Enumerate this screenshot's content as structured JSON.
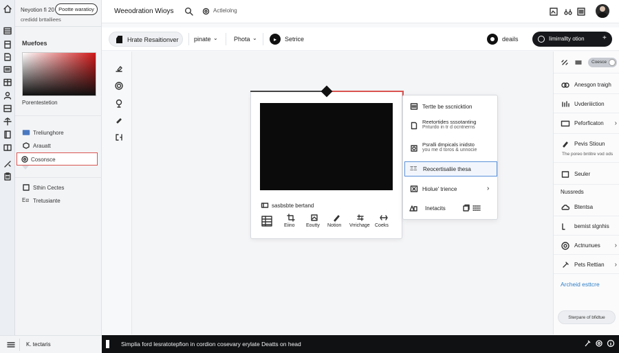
{
  "sidebar": {
    "header_line1": "Neyotion fi 20",
    "header_line2": "credidd brttalliees",
    "header_button": "Pootte waratioy",
    "section_title": "Muefoes",
    "color_label": "Porentestetion",
    "items": [
      {
        "label": "Treliunghore",
        "icon": "layers-icon"
      },
      {
        "label": "Arauatt",
        "icon": "cube-icon"
      },
      {
        "label": "Cosonsce",
        "icon": "circle-icon"
      }
    ],
    "items2": [
      {
        "label": "Sthin Cectes",
        "icon": "square-icon"
      },
      {
        "label": "Tretusiante",
        "icon": "text-icon"
      }
    ],
    "footer_label": "K. tectaris"
  },
  "topbar": {
    "title": "Weeodration Wioys",
    "search_label": "Actlelolng"
  },
  "toolbar": {
    "primary_chip": "Hrate Resaitionver",
    "dropdown1": "pinate",
    "dropdown2": "Phota",
    "service_label": "Setrice",
    "details_label": "deails",
    "action_button": "Iimirrallty otion"
  },
  "frame": {
    "caption": "sasbsbte bertand",
    "actions": [
      "Eiino",
      "Eoutty",
      "Notion",
      "Vrrichage",
      "Coeks"
    ]
  },
  "context_menu": {
    "items": [
      {
        "label": "Tertte be sscnicktion"
      },
      {
        "label": "Reetortides sssotanting",
        "sub": "Pnturdo in tr d ocntnerns"
      },
      {
        "label": "Psralli dmpicals inidsto",
        "sub": "you me d toros & unnocie"
      },
      {
        "label": "Reocertisaliie thesa"
      },
      {
        "label": "Hiolue' trience"
      },
      {
        "label": "Inetacits"
      }
    ]
  },
  "rightpanel": {
    "toggle_label": "Coesce",
    "rows": [
      {
        "label": "Anesgon traigh",
        "icon": "link-icon"
      },
      {
        "label": "Uvderiiiction",
        "icon": "bars-icon"
      },
      {
        "label": "Peforficaton",
        "icon": "rectangle-icon"
      },
      {
        "label": "Pevis Stioun",
        "icon": "pen-icon"
      }
    ],
    "note": "The poreo bntitre vod ods",
    "row_seuler": "Seuler",
    "section_label": "Nussreds",
    "rows2": [
      {
        "label": "Btentsa",
        "icon": "cloud-icon"
      },
      {
        "label": "bemist slgnhis",
        "icon": "sliders-icon"
      },
      {
        "label": "Actnunues",
        "icon": "target-icon"
      },
      {
        "label": "Pets Rettian",
        "icon": "pin-icon"
      }
    ],
    "link": "Archeid esttcre",
    "bottom_button": "Sterpare of bfidtue"
  },
  "statusbar": {
    "message": "Simplia ford lesratotepfion in cordion cosevary erylate Deatts on head"
  },
  "colors": {
    "accent_red": "#d9534f",
    "selected_blue": "#5a8fd8",
    "link_blue": "#2f7fc6",
    "dark": "#0f1113"
  }
}
